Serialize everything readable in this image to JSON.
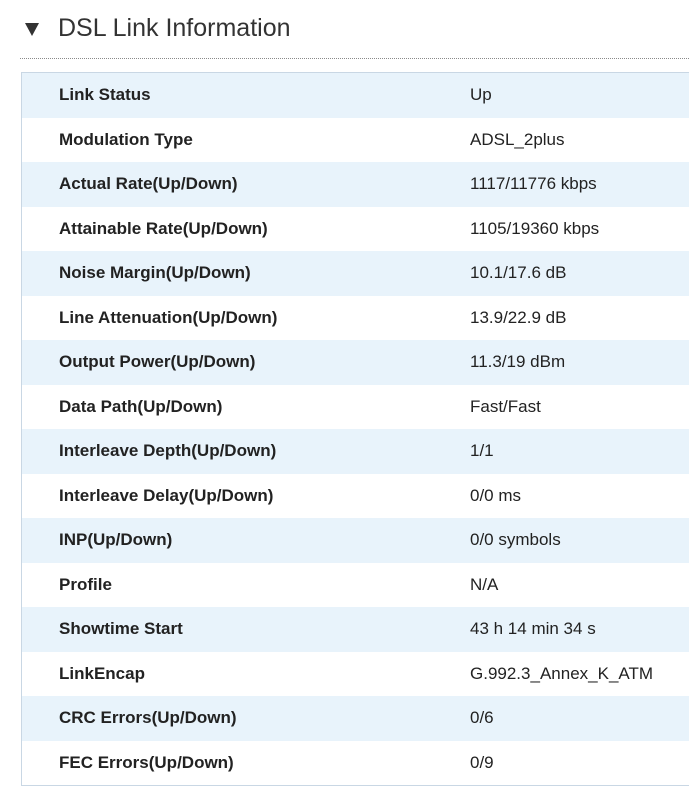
{
  "section": {
    "title": "DSL Link Information",
    "toggle_icon": "triangle-down-icon"
  },
  "rows": [
    {
      "label": "Link Status",
      "value": "Up"
    },
    {
      "label": "Modulation Type",
      "value": "ADSL_2plus"
    },
    {
      "label": "Actual Rate(Up/Down)",
      "value": "1117/11776 kbps"
    },
    {
      "label": "Attainable Rate(Up/Down)",
      "value": "1105/19360 kbps"
    },
    {
      "label": "Noise Margin(Up/Down)",
      "value": "10.1/17.6 dB"
    },
    {
      "label": "Line Attenuation(Up/Down)",
      "value": "13.9/22.9 dB"
    },
    {
      "label": "Output Power(Up/Down)",
      "value": "11.3/19 dBm"
    },
    {
      "label": "Data Path(Up/Down)",
      "value": "Fast/Fast"
    },
    {
      "label": "Interleave Depth(Up/Down)",
      "value": "1/1"
    },
    {
      "label": "Interleave Delay(Up/Down)",
      "value": "0/0 ms"
    },
    {
      "label": "INP(Up/Down)",
      "value": "0/0 symbols"
    },
    {
      "label": "Profile",
      "value": "N/A"
    },
    {
      "label": "Showtime Start",
      "value": "43 h 14 min 34 s"
    },
    {
      "label": "LinkEncap",
      "value": "G.992.3_Annex_K_ATM"
    },
    {
      "label": "CRC Errors(Up/Down)",
      "value": "0/6"
    },
    {
      "label": "FEC Errors(Up/Down)",
      "value": "0/9"
    }
  ],
  "colors": {
    "row_alt": "#e8f3fb",
    "row_plain": "#ffffff",
    "border": "#c9d7e4",
    "text": "#222222"
  }
}
